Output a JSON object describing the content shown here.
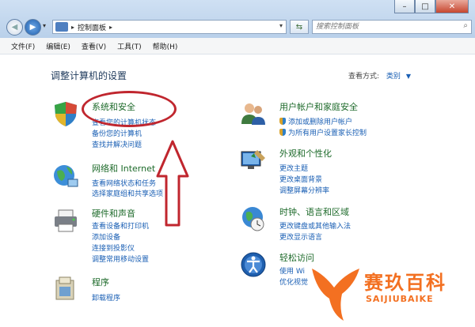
{
  "address": {
    "root_label": "控制面板"
  },
  "search": {
    "placeholder": "搜索控制面板"
  },
  "menu": [
    "文件(F)",
    "编辑(E)",
    "查看(V)",
    "工具(T)",
    "帮助(H)"
  ],
  "page_title": "调整计算机的设置",
  "view_by": {
    "label": "查看方式:",
    "value": "类别"
  },
  "categories": [
    {
      "title": "系统和安全",
      "links": [
        "查看您的计算机状态",
        "备份您的计算机",
        "查找并解决问题"
      ]
    },
    {
      "title": "网络和 Internet",
      "links": [
        "查看网络状态和任务",
        "选择家庭组和共享选项"
      ]
    },
    {
      "title": "硬件和声音",
      "links": [
        "查看设备和打印机",
        "添加设备",
        "连接到投影仪",
        "调整常用移动设置"
      ]
    },
    {
      "title": "程序",
      "links": [
        "卸载程序"
      ]
    },
    {
      "title": "用户帐户和家庭安全",
      "links": [
        "添加或删除用户帐户",
        "为所有用户设置家长控制"
      ]
    },
    {
      "title": "外观和个性化",
      "links": [
        "更改主题",
        "更改桌面背景",
        "调整屏幕分辨率"
      ]
    },
    {
      "title": "时钟、语言和区域",
      "links": [
        "更改键盘或其他输入法",
        "更改显示语言"
      ]
    },
    {
      "title": "轻松访问",
      "links": [
        "使用 Wi",
        "优化视觉"
      ]
    }
  ],
  "watermark": {
    "brand_cn": "赛玖百科",
    "brand_en": "SAIJIUBAIKE"
  },
  "colors": {
    "category_title": "#1d6a2a",
    "link": "#1a5fb4",
    "annotation": "#c0262e",
    "watermark": "#f37021"
  }
}
